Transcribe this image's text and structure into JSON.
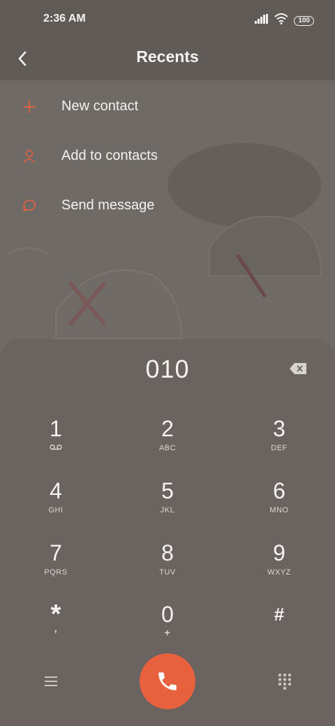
{
  "status_bar": {
    "time": "2:36 AM",
    "battery": "100"
  },
  "header": {
    "title": "Recents"
  },
  "menu": [
    {
      "label": "New contact",
      "icon": "plus-icon"
    },
    {
      "label": "Add to contacts",
      "icon": "person-icon"
    },
    {
      "label": "Send message",
      "icon": "message-bubble-icon"
    }
  ],
  "dialer": {
    "number": "010",
    "keys": [
      {
        "digit": "1",
        "letters": ""
      },
      {
        "digit": "2",
        "letters": "ABC"
      },
      {
        "digit": "3",
        "letters": "DEF"
      },
      {
        "digit": "4",
        "letters": "GHI"
      },
      {
        "digit": "5",
        "letters": "JKL"
      },
      {
        "digit": "6",
        "letters": "MNO"
      },
      {
        "digit": "7",
        "letters": "PQRS"
      },
      {
        "digit": "8",
        "letters": "TUV"
      },
      {
        "digit": "9",
        "letters": "WXYZ"
      },
      {
        "digit": "*",
        "letters": ","
      },
      {
        "digit": "0",
        "letters": "+"
      },
      {
        "digit": "#",
        "letters": ""
      }
    ]
  },
  "colors": {
    "accent": "#e8613e",
    "background": "#6a635f",
    "text": "#f4f2f0"
  }
}
